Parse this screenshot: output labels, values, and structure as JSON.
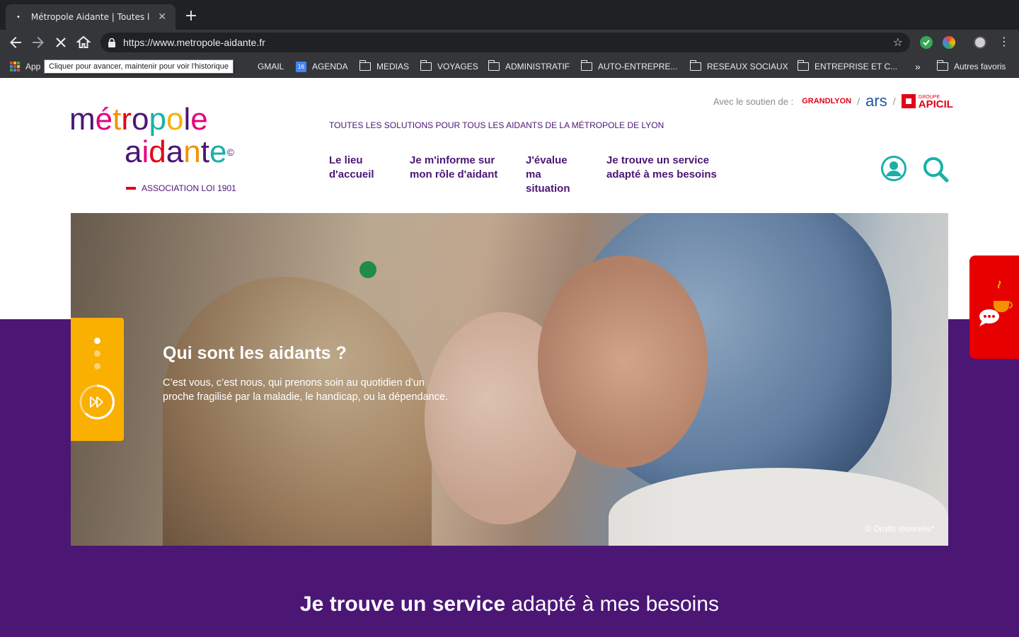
{
  "browser": {
    "tab_title": "Métropole Aidante | Toutes les",
    "tab_close": "✕",
    "new_tab": "+",
    "url": "https://www.metropole-aidante.fr",
    "tooltip": "Cliquer pour avancer, maintenir pour voir l'historique",
    "bookmarks": {
      "apps": "App",
      "gmail": "GMAIL",
      "agenda_day": "16",
      "agenda": "AGENDA",
      "medias": "MEDIAS",
      "voyages": "VOYAGES",
      "administratif": "ADMINISTRATIF",
      "auto": "AUTO-ENTREPRE...",
      "reseaux": "RESEAUX SOCIAUX",
      "entreprise": "ENTREPRISE ET C...",
      "more": "»",
      "autres": "Autres favoris"
    }
  },
  "site": {
    "logo": {
      "line1": "métropole",
      "line2": "aidante",
      "copyright": "©",
      "association": "ASSOCIATION LOI 1901"
    },
    "sponsors": {
      "label": "Avec le soutien de :",
      "grandlyon": "GRANDLYON",
      "ars": "ars",
      "apicil_small": "GROUPE",
      "apicil": "APICIL"
    },
    "tagline": "TOUTES LES SOLUTIONS POUR TOUS LES AIDANTS DE LA MÉTROPOLE DE LYON",
    "nav": [
      {
        "line1": "Le lieu",
        "line2": "d'accueil"
      },
      {
        "line1": "Je m'informe sur",
        "line2": "mon rôle d'aidant"
      },
      {
        "line1": "J'évalue ma",
        "line2": "situation"
      },
      {
        "line1": "Je trouve un service",
        "line2": "adapté à mes besoins"
      }
    ],
    "hero": {
      "title": "Qui sont les aidants ?",
      "text": "C’est vous, c’est nous, qui prenons soin au quotidien d’un proche fragilisé par la maladie, le handicap, ou la dépendance.",
      "credit": "© Droits réservés*"
    },
    "section": {
      "heading_bold": "Je trouve un service",
      "heading_light": " adapté à mes besoins"
    }
  },
  "colors": {
    "brand_purple": "#4c1675",
    "slider_yellow": "#f9b000",
    "chat_red": "#e60000",
    "teal": "#1ab0a8"
  }
}
